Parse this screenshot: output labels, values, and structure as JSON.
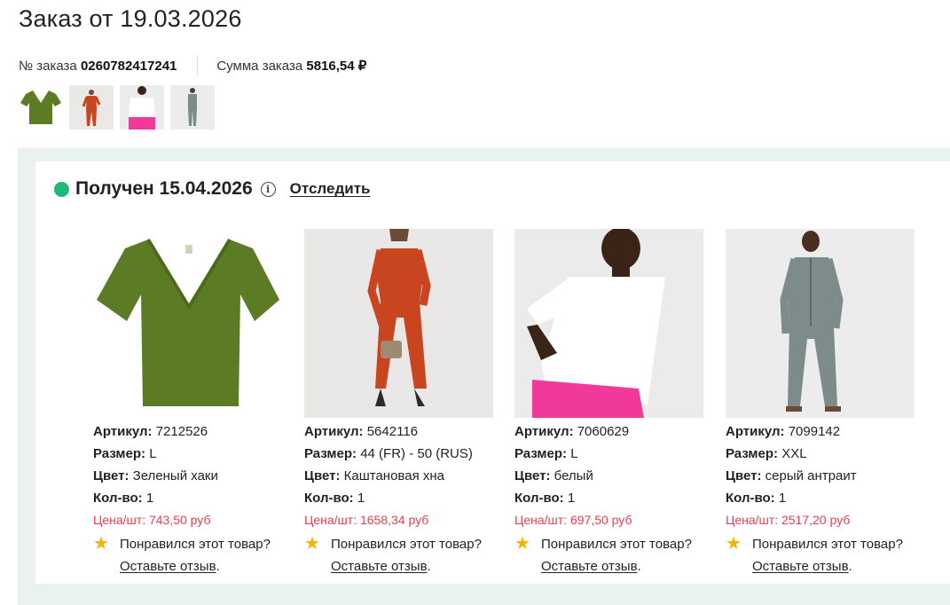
{
  "order": {
    "title": "Заказ от 19.03.2026",
    "number_label": "№ заказа",
    "number_value": "0260782417241",
    "sum_label": "Сумма заказа",
    "sum_value": "5816,54 ₽"
  },
  "shipment": {
    "status": "Получен 15.04.2026",
    "track_label": "Отследить",
    "info_icon": "info-icon",
    "status_color": "#1fb877"
  },
  "labels": {
    "article": "Артикул:",
    "size": "Размер:",
    "color": "Цвет:",
    "qty": "Кол-во:",
    "review_text": "Понравился этот товар?",
    "review_link": "Оставьте отзыв",
    "review_end": "."
  },
  "products": [
    {
      "article": "7212526",
      "size": "L",
      "color": "Зеленый хаки",
      "qty": "1",
      "price": "Цена/шт: 743,50 руб"
    },
    {
      "article": "5642116",
      "size": "44 (FR) - 50 (RUS)",
      "color": "Каштановая хна",
      "qty": "1",
      "price": "Цена/шт: 1658,34 руб"
    },
    {
      "article": "7060629",
      "size": "L",
      "color": "белый",
      "qty": "1",
      "price": "Цена/шт: 697,50 руб"
    },
    {
      "article": "7099142",
      "size": "XXL",
      "color": "серый антраит",
      "qty": "1",
      "price": "Цена/шт: 2517,20 руб"
    }
  ],
  "colors": {
    "price": "#e43e52",
    "star": "#f4b400",
    "panel_bg": "#eaf2ef"
  }
}
